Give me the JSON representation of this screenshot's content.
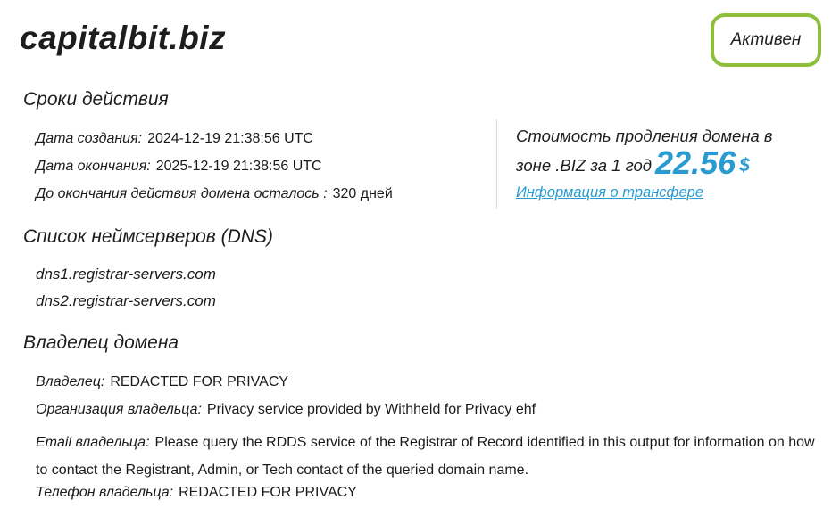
{
  "domain_name": "capitalbit.biz",
  "status": "Активен",
  "validity": {
    "heading": "Сроки действия",
    "created_label": "Дата создания:",
    "created_value": "2024-12-19 21:38:56 UTC",
    "expires_label": "Дата окончания:",
    "expires_value": "2025-12-19 21:38:56 UTC",
    "remaining_label": "До окончания действия домена осталось :",
    "remaining_value": "320 дней"
  },
  "renewal": {
    "line1": "Стоимость продления домена в",
    "line2": "зоне .BIZ за 1 год",
    "price": "22.56",
    "currency": "$",
    "transfer_link": "Информация о трансфере"
  },
  "dns": {
    "heading": "Список неймсерверов (DNS)",
    "servers": [
      "dns1.registrar-servers.com",
      "dns2.registrar-servers.com"
    ]
  },
  "owner": {
    "heading": "Владелец домена",
    "owner_label": "Владелец:",
    "owner_value": "REDACTED FOR PRIVACY",
    "org_label": "Организация владельца:",
    "org_value": "Privacy service provided by Withheld for Privacy ehf",
    "email_label": "Email владельца:",
    "email_value": "Please query the RDDS service of the Registrar of Record identified in this output for information on how to contact the Registrant, Admin, or Tech contact of the queried domain name.",
    "phone_label": "Телефон владельца:",
    "phone_value": "REDACTED FOR PRIVACY"
  },
  "colors": {
    "status_border": "#8dbf3a",
    "accent_blue": "#2a9bd0"
  }
}
